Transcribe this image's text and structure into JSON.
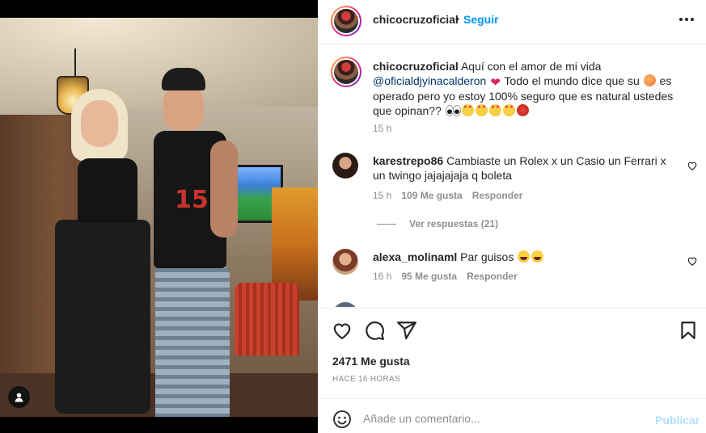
{
  "post": {
    "username": "chicocruzoficial",
    "separator": "•",
    "follow_label": "Seguir",
    "more_icon": "more-horizontal-icon",
    "tag_icon": "person-tag-icon"
  },
  "caption": {
    "username": "chicocruzoficial",
    "text_1": "Aquí con el amor de mi vida",
    "mention": "@oficialdjyinacalderon",
    "text_2": "Todo el mundo dice que su",
    "text_3": "es operado pero yo estoy 100% seguro que es natural ustedes que opinan??",
    "time": "15 h"
  },
  "comments": [
    {
      "username": "karestrepo86",
      "text": "Cambiaste un Rolex x un Casio un Ferrari x un twingo jajajajaja q boleta",
      "time": "15 h",
      "likes": "109 Me gusta",
      "reply_label": "Responder",
      "view_replies": "Ver respuestas (21)"
    },
    {
      "username": "alexa_molinaml",
      "text": "Par guisos",
      "time": "16 h",
      "likes": "95 Me gusta",
      "reply_label": "Responder"
    }
  ],
  "actions": {
    "likes_count": "2471 Me gusta",
    "date": "HACE 16 HORAS"
  },
  "composer": {
    "placeholder": "Añade un comentario...",
    "post_label": "Publicar"
  },
  "colors": {
    "accent": "#0095f6",
    "accent_disabled": "#b2dffc",
    "mention": "#00376b",
    "secondary_text": "#8e8e8e"
  }
}
